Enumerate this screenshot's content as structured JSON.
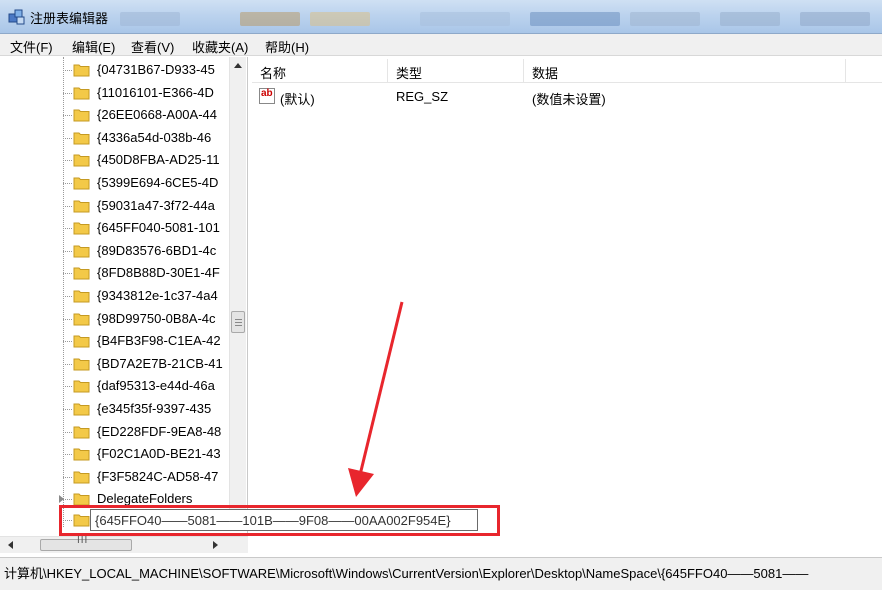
{
  "window": {
    "title": "注册表编辑器"
  },
  "menu": {
    "items": [
      "文件(F)",
      "编辑(E)",
      "查看(V)",
      "收藏夹(A)",
      "帮助(H)"
    ]
  },
  "tree": {
    "items": [
      "{04731B67-D933-45",
      "{11016101-E366-4D",
      "{26EE0668-A00A-44",
      "{4336a54d-038b-46",
      "{450D8FBA-AD25-11",
      "{5399E694-6CE5-4D",
      "{59031a47-3f72-44a",
      "{645FF040-5081-101",
      "{89D83576-6BD1-4c",
      "{8FD8B88D-30E1-4F",
      "{9343812e-1c37-4a4",
      "{98D99750-0B8A-4c",
      "{B4FB3F98-C1EA-42",
      "{BD7A2E7B-21CB-41",
      "{daf95313-e44d-46a",
      "{e345f35f-9397-435",
      "{ED228FDF-9EA8-48",
      "{F02C1A0D-BE21-43",
      "{F3F5824C-AD58-47",
      "DelegateFolders"
    ],
    "editing_value": "{645FFO40——5081——101B——9F08——00AA002F954E}",
    "hscroll_grip": "III"
  },
  "list": {
    "columns": [
      "名称",
      "类型",
      "数据"
    ],
    "rows": [
      {
        "name": "(默认)",
        "type": "REG_SZ",
        "data": "(数值未设置)",
        "icon": "string-value-icon"
      }
    ]
  },
  "status": {
    "path": "计算机\\HKEY_LOCAL_MACHINE\\SOFTWARE\\Microsoft\\Windows\\CurrentVersion\\Explorer\\Desktop\\NameSpace\\{645FFO40——5081——"
  },
  "colors": {
    "annotation_red": "#e8262d",
    "folder_yellow": "#f3c948"
  }
}
